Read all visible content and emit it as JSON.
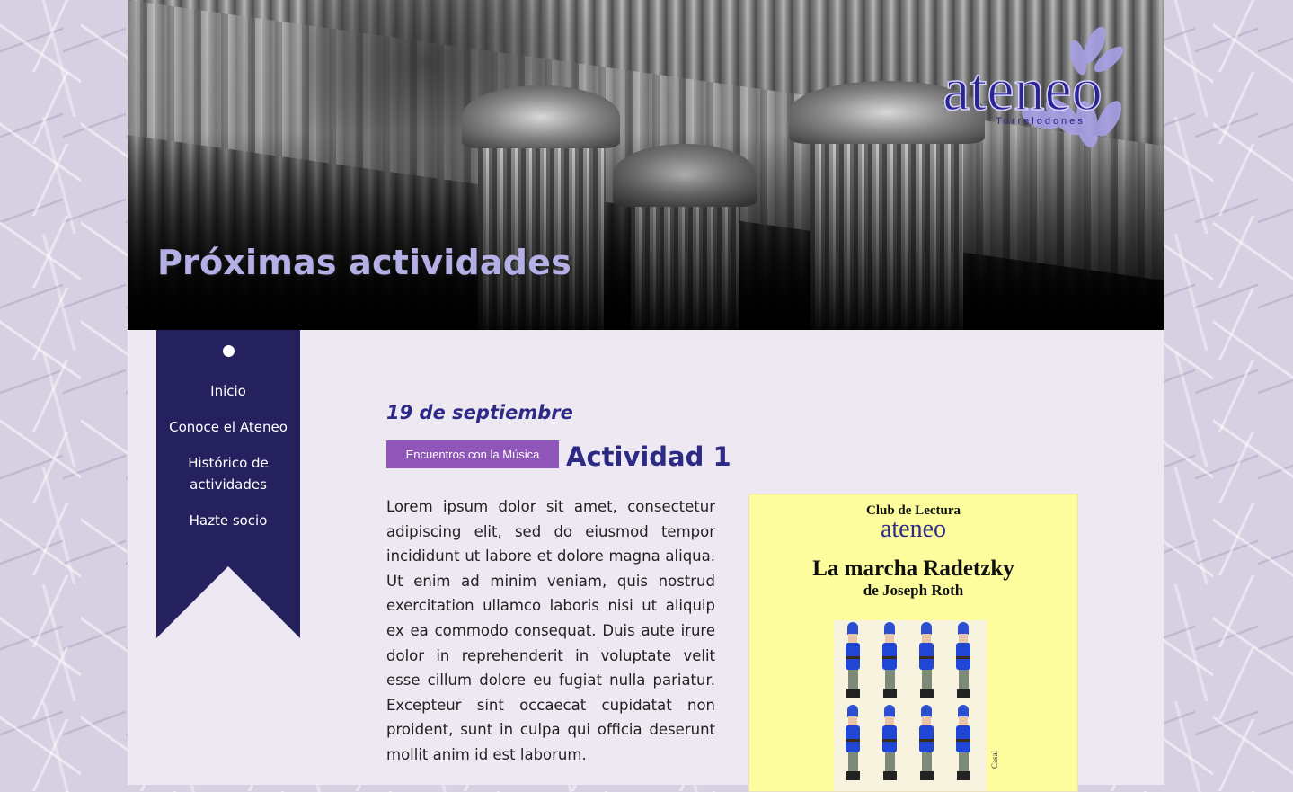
{
  "hero": {
    "title": "Próximas actividades"
  },
  "logo": {
    "name": "ateneo",
    "sub": "Torrelodones"
  },
  "nav": {
    "items": [
      {
        "label": "Inicio"
      },
      {
        "label": "Conoce el Ateneo"
      },
      {
        "label": "Histórico de actividades"
      },
      {
        "label": "Hazte socio"
      }
    ]
  },
  "event": {
    "date": "19 de septiembre",
    "category": "Encuentros con la Música",
    "title": "Actividad 1",
    "description": "Lorem ipsum dolor sit amet, consectetur adipiscing elit, sed do eiusmod tempor incididunt ut labore et dolore magna aliqua. Ut enim ad minim veniam, quis nostrud exercitation ullamco laboris nisi ut aliquip ex ea commodo consequat. Duis aute irure dolor in reprehenderit in voluptate velit esse cillum dolore eu fugiat nulla pariatur. Excepteur sint occaecat cupidatat non proident, sunt in culpa qui officia deserunt mollit anim id est laborum."
  },
  "poster": {
    "club": "Club de Lectura",
    "logo": "ateneo",
    "title": "La marcha Radetzky",
    "author": "de Joseph Roth",
    "credit": "Casal"
  },
  "colors": {
    "accent": "#2c2a85",
    "sidebar": "#25205e",
    "category_bg": "#8f55b8",
    "hero_title": "#b4b0e6",
    "poster_bg": "#fdfd9d"
  },
  "icons": {
    "sidebar_marker": "dot-icon"
  }
}
